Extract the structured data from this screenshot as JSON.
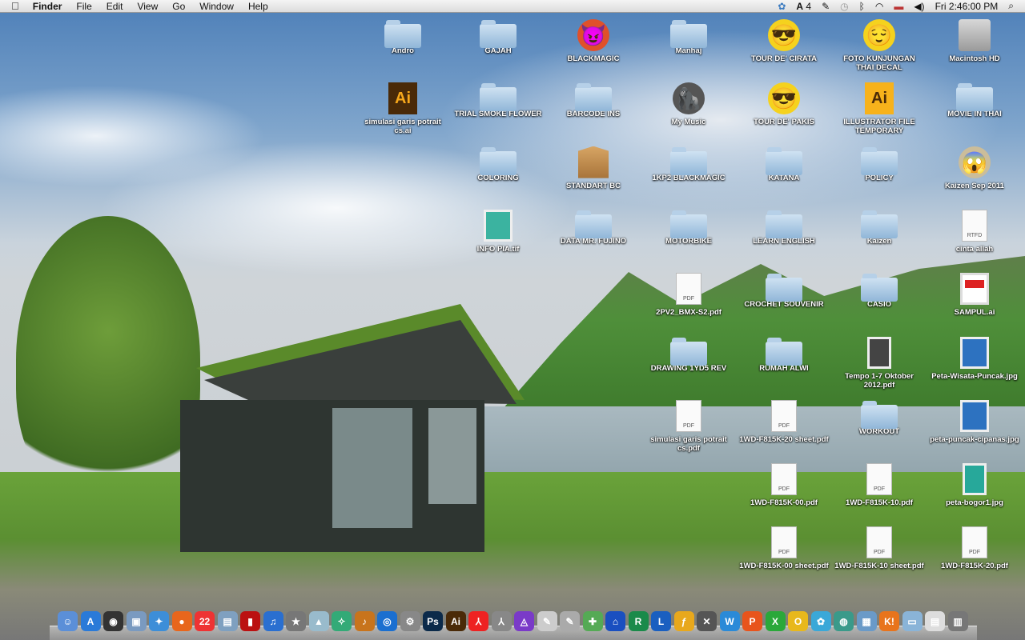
{
  "menubar": {
    "apple": "",
    "app": "Finder",
    "items": [
      "File",
      "Edit",
      "View",
      "Go",
      "Window",
      "Help"
    ],
    "status": {
      "adobe_count": "4",
      "clock": "Fri 2:46:00 PM",
      "icons": [
        "sync-icon",
        "adobe-icon",
        "script-icon",
        "time-machine-icon",
        "bluetooth-icon",
        "wifi-icon",
        "flag-icon",
        "volume-icon",
        "spotlight-icon"
      ]
    }
  },
  "desktop": {
    "items": [
      {
        "label": "Andro",
        "icon": "folder"
      },
      {
        "label": "GAJAH",
        "icon": "folder"
      },
      {
        "label": "BLACKMAGIC",
        "icon": "devil"
      },
      {
        "label": "Manhaj",
        "icon": "folder"
      },
      {
        "label": "TOUR DE' CIRATA",
        "icon": "sunglasses"
      },
      {
        "label": "FOTO KUNJUNGAN THAI DECAL",
        "icon": "smiley"
      },
      {
        "label": "Macintosh HD",
        "icon": "drive"
      },
      {
        "label": "simulasi garis potrait cs.ai",
        "icon": "ai"
      },
      {
        "label": "TRIAL SMOKE FLOWER",
        "icon": "folder"
      },
      {
        "label": "BARCODE INS",
        "icon": "folder"
      },
      {
        "label": "My Music",
        "icon": "gorilla"
      },
      {
        "label": "TOUR DE' PAKIS",
        "icon": "sunglasses"
      },
      {
        "label": "ILLUSTRATOR FILE TEMPORARY",
        "icon": "ai2"
      },
      {
        "label": "MOVIE IN THAI",
        "icon": "folder"
      },
      {
        "label": "COLORING",
        "icon": "folder"
      },
      {
        "label": "STANDART BC",
        "icon": "box"
      },
      {
        "label": "1KP2 BLACKMAGIC",
        "icon": "folder"
      },
      {
        "label": "KATANA",
        "icon": "folder"
      },
      {
        "label": "POLICY",
        "icon": "folder"
      },
      {
        "label": "Kaizen Sep 2011",
        "icon": "scream"
      },
      {
        "label": "INFO PIA.tif",
        "icon": "image"
      },
      {
        "label": "DATA MR. FUJINO",
        "icon": "folder"
      },
      {
        "label": "MOTORBIKE",
        "icon": "folder"
      },
      {
        "label": "LEARN ENGLISH",
        "icon": "folder"
      },
      {
        "label": "Kaizen",
        "icon": "folder"
      },
      {
        "label": "cinta allah",
        "icon": "rtfd"
      },
      {
        "label": "2PV2_BMX-S2.pdf",
        "icon": "lock-pdf"
      },
      {
        "label": "CROCHET SOUVENIR",
        "icon": "folder"
      },
      {
        "label": "CASIO",
        "icon": "folder"
      },
      {
        "label": "SAMPUL.ai",
        "icon": "sampul"
      },
      {
        "label": "DRAWING 1YD5 REV",
        "icon": "folder"
      },
      {
        "label": "RUMAH ALWI",
        "icon": "folder"
      },
      {
        "label": "Tempo 1-7 Oktober 2012.pdf",
        "icon": "tempo"
      },
      {
        "label": "Peta-Wisata-Puncak.jpg",
        "icon": "map"
      },
      {
        "label": "simulasi garis potrait cs.pdf",
        "icon": "pdf"
      },
      {
        "label": "1WD-F815K-20 sheet.pdf",
        "icon": "pdf"
      },
      {
        "label": "WORKOUT",
        "icon": "folder"
      },
      {
        "label": "peta-puncak-cipanas.jpg",
        "icon": "map"
      },
      {
        "label": "1WD-F815K-00.pdf",
        "icon": "pdf"
      },
      {
        "label": "1WD-F815K-10.pdf",
        "icon": "pdf"
      },
      {
        "label": "peta-bogor1.jpg",
        "icon": "teal-map"
      },
      {
        "label": "1WD-F815K-00 sheet.pdf",
        "icon": "pdf"
      },
      {
        "label": "1WD-F815K-10 sheet.pdf",
        "icon": "pdf"
      },
      {
        "label": "1WD-F815K-20.pdf",
        "icon": "pdf"
      }
    ]
  },
  "dock": {
    "items": [
      {
        "name": "finder",
        "glyph": "☺",
        "color": "#5b8fd8"
      },
      {
        "name": "app-store",
        "glyph": "A",
        "color": "#2a7ad8"
      },
      {
        "name": "dashboard",
        "glyph": "◉",
        "color": "#333"
      },
      {
        "name": "preview",
        "glyph": "▣",
        "color": "#7a9ac0"
      },
      {
        "name": "safari",
        "glyph": "✦",
        "color": "#3d8ed8"
      },
      {
        "name": "firefox",
        "glyph": "●",
        "color": "#e8661c"
      },
      {
        "name": "calendar",
        "glyph": "22",
        "color": "#e33"
      },
      {
        "name": "iphoto",
        "glyph": "▤",
        "color": "#7fa0c0"
      },
      {
        "name": "photo-booth",
        "glyph": "▮",
        "color": "#b11"
      },
      {
        "name": "itunes",
        "glyph": "♫",
        "color": "#2a6fd0"
      },
      {
        "name": "imovie",
        "glyph": "★",
        "color": "#777"
      },
      {
        "name": "preview-2",
        "glyph": "▲",
        "color": "#9bc"
      },
      {
        "name": "xcode-tools",
        "glyph": "✧",
        "color": "#3a7"
      },
      {
        "name": "garageband",
        "glyph": "♪",
        "color": "#c8741c"
      },
      {
        "name": "dvd-player",
        "glyph": "◎",
        "color": "#1a6fd0"
      },
      {
        "name": "system-preferences",
        "glyph": "⚙",
        "color": "#888"
      },
      {
        "name": "photoshop",
        "glyph": "Ps",
        "color": "#0b2a4a"
      },
      {
        "name": "illustrator",
        "glyph": "Ai",
        "color": "#4a2a08"
      },
      {
        "name": "acrobat-reader",
        "glyph": "⅄",
        "color": "#e22"
      },
      {
        "name": "acrobat-pro",
        "glyph": "⅄",
        "color": "#888"
      },
      {
        "name": "autodesk",
        "glyph": "◬",
        "color": "#7a3ac8"
      },
      {
        "name": "textedit",
        "glyph": "✎",
        "color": "#ccc"
      },
      {
        "name": "script-editor",
        "glyph": "✎",
        "color": "#aaa"
      },
      {
        "name": "maps",
        "glyph": "✚",
        "color": "#5a5"
      },
      {
        "name": "home-app",
        "glyph": "⌂",
        "color": "#1a4fc0"
      },
      {
        "name": "green-app",
        "glyph": "R",
        "color": "#1a8a4a"
      },
      {
        "name": "blue-app",
        "glyph": "L",
        "color": "#1a5fc0"
      },
      {
        "name": "flash",
        "glyph": "ƒ",
        "color": "#e8a81c"
      },
      {
        "name": "utilities",
        "glyph": "✕",
        "color": "#555"
      },
      {
        "name": "word",
        "glyph": "W",
        "color": "#2a8ad8"
      },
      {
        "name": "powerpoint",
        "glyph": "P",
        "color": "#e8541c"
      },
      {
        "name": "excel",
        "glyph": "X",
        "color": "#2aa83a"
      },
      {
        "name": "outlook",
        "glyph": "O",
        "color": "#e8b81c"
      },
      {
        "name": "messenger",
        "glyph": "✿",
        "color": "#3aa8d8"
      },
      {
        "name": "network",
        "glyph": "◍",
        "color": "#3a9a8a"
      },
      {
        "name": "image-app",
        "glyph": "▦",
        "color": "#6a9ac8"
      },
      {
        "name": "keynote-app",
        "glyph": "K!",
        "color": "#e8741c"
      },
      {
        "name": "applications-folder",
        "glyph": "▭",
        "color": "#8ab4d8"
      },
      {
        "name": "documents-stack",
        "glyph": "▤",
        "color": "#ddd"
      },
      {
        "name": "trash",
        "glyph": "▥",
        "color": "#777"
      }
    ]
  }
}
